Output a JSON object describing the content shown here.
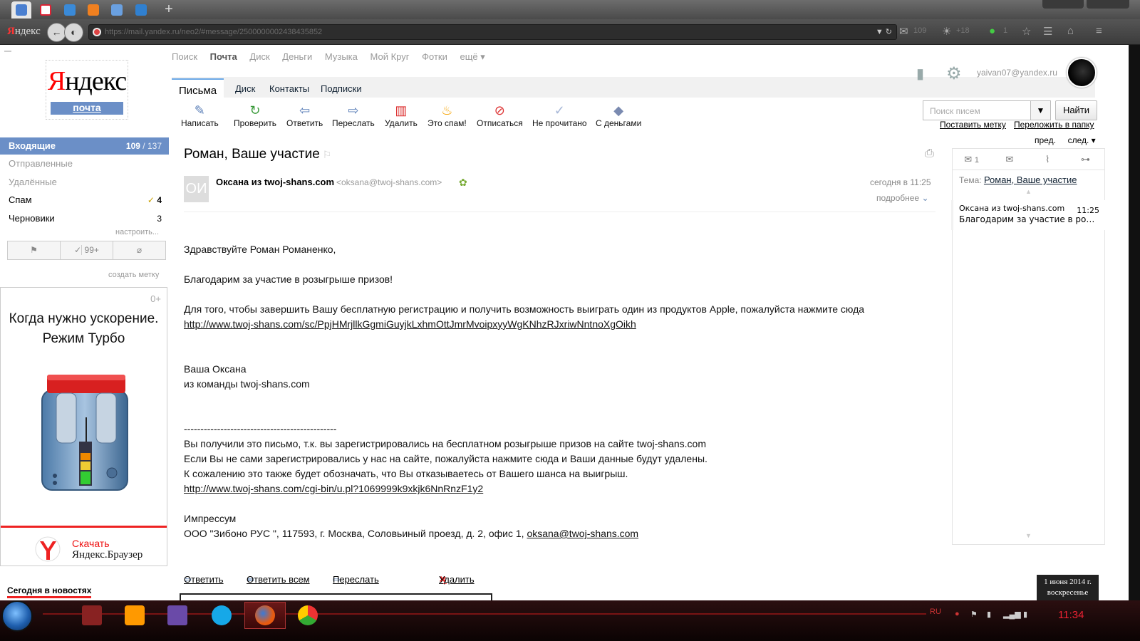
{
  "browser": {
    "brand": "Яндекс",
    "url": "https://mail.yandex.ru/neo2/#message/2500000002438435852",
    "mail_count": "109",
    "weather": "+18",
    "counter": "1",
    "tab_favicons": [
      "#4a7fd0",
      "#d23",
      "#3a8ad8",
      "#f08020",
      "#6aa0e0",
      "#3080d0"
    ]
  },
  "logo": {
    "text_y": "Я",
    "text_rest": "ндекс",
    "sub": "почта"
  },
  "services": [
    "Поиск",
    "Почта",
    "Диск",
    "Деньги",
    "Музыка",
    "Мой Круг",
    "Фотки",
    "ещё ▾"
  ],
  "tabs": [
    "Письма",
    "Диск",
    "Контакты",
    "Подписки"
  ],
  "user": {
    "email": "yaivan07@yandex.ru"
  },
  "toolbar": {
    "items": [
      {
        "label": "Написать",
        "icon": "✎",
        "color": "#5b7fb8"
      },
      {
        "label": "Проверить",
        "icon": "↻",
        "color": "#3a9a3a"
      },
      {
        "label": "Ответить",
        "icon": "⇦",
        "color": "#5b7fb8"
      },
      {
        "label": "Переслать",
        "icon": "⇨",
        "color": "#5b7fb8"
      },
      {
        "label": "Удалить",
        "icon": "🗑",
        "color": "#d33"
      },
      {
        "label": "Это спам!",
        "icon": "🔥",
        "color": "#f5a300"
      },
      {
        "label": "Отписаться",
        "icon": "⊘",
        "color": "#d33"
      },
      {
        "label": "Не прочитано",
        "icon": "✓",
        "color": "#a8b8d8"
      },
      {
        "label": "С деньгами",
        "icon": "◆",
        "color": "#7a8ab0"
      }
    ]
  },
  "search": {
    "placeholder": "Поиск писем",
    "button": "Найти",
    "put_label": "Поставить метку",
    "move_folder": "Переложить в папку",
    "prev": "пред.",
    "next": "след. ▾"
  },
  "folders": [
    {
      "name": "Входящие",
      "count": "109",
      "total": "/ 137"
    },
    {
      "name": "Отправленные",
      "count": ""
    },
    {
      "name": "Удалённые",
      "count": ""
    },
    {
      "name": "Спам",
      "count": "4"
    },
    {
      "name": "Черновики",
      "count": "3"
    }
  ],
  "sidebar": {
    "configure": "настроить...",
    "filter_done": "99+",
    "create_label": "создать метку"
  },
  "ad": {
    "counter": "0+",
    "title_line1": "Когда нужно ускорение.",
    "title_line2": "Режим Турбо",
    "cta": "Скачать",
    "brand": "Яндекс.Браузер"
  },
  "news_label": "Сегодня в новостях",
  "message": {
    "subject": "Роман, Ваше участие",
    "avatar_initials": "ОИ",
    "sender_name": "Оксана из twoj-shans.com",
    "sender_email": "<oksana@twoj-shans.com>",
    "date": "сегодня в 11:25",
    "more": "подробнее",
    "greeting": "Здравствуйте Роман Романенко,",
    "thanks": "Благодарим за участие в розыгрыше призов!",
    "instruction": "Для того, чтобы завершить Вашу бесплатную регистрацию и получить возможность выиграть один из продуктов Apple, пожалуйста нажмите сюда",
    "link1": "http://www.twoj-shans.com/sc/PpjHMrjllkGgmiGuyjkLxhmOttJmrMvoipxyyWgKNhzRJxriwNntnoXgOikh",
    "sign1": "Ваша Оксана",
    "sign2": "из команды twoj-shans.com",
    "divider": "----------------------------------------------",
    "footer1": "Вы получили это письмо, т.к. вы зарегистрировались на бесплатном розыгрыше призов на сайте twoj-shans.com",
    "footer2": "Если Вы не сами зарегистрировались у нас на сайте, пожалуйста нажмите сюда и Ваши данные будут удалены.",
    "footer3": "К сожалению это также  будет обозначать, что Вы отказываетесь от Вашего шанса на выигрыш.",
    "link2": "http://www.twoj-shans.com/cgi-bin/u.pl?1069999k9xkjk6NnRnzF1y2",
    "impressum": "Импрессум",
    "company": "ООО \"Зибоно РУС \", 117593, г. Москва, Соловьиный проезд, д. 2, офис 1, ",
    "company_email": "oksana@twoj-shans.com"
  },
  "actions": {
    "reply": "Ответить",
    "reply_all": "Ответить всем",
    "forward": "Переслать",
    "delete": "Удалить"
  },
  "thread": {
    "count": "1",
    "topic_label": "Тема:",
    "topic": "Роман, Ваше участие",
    "from": "Оксана из twoj-shans.com",
    "time": "11:25",
    "snippet": "Благодарим за участие в розыгрыше призов!"
  },
  "date_tooltip": {
    "line1": "1 июня 2014 г.",
    "line2": "воскресенье"
  },
  "taskbar": {
    "lang": "RU",
    "time": "11:34"
  }
}
